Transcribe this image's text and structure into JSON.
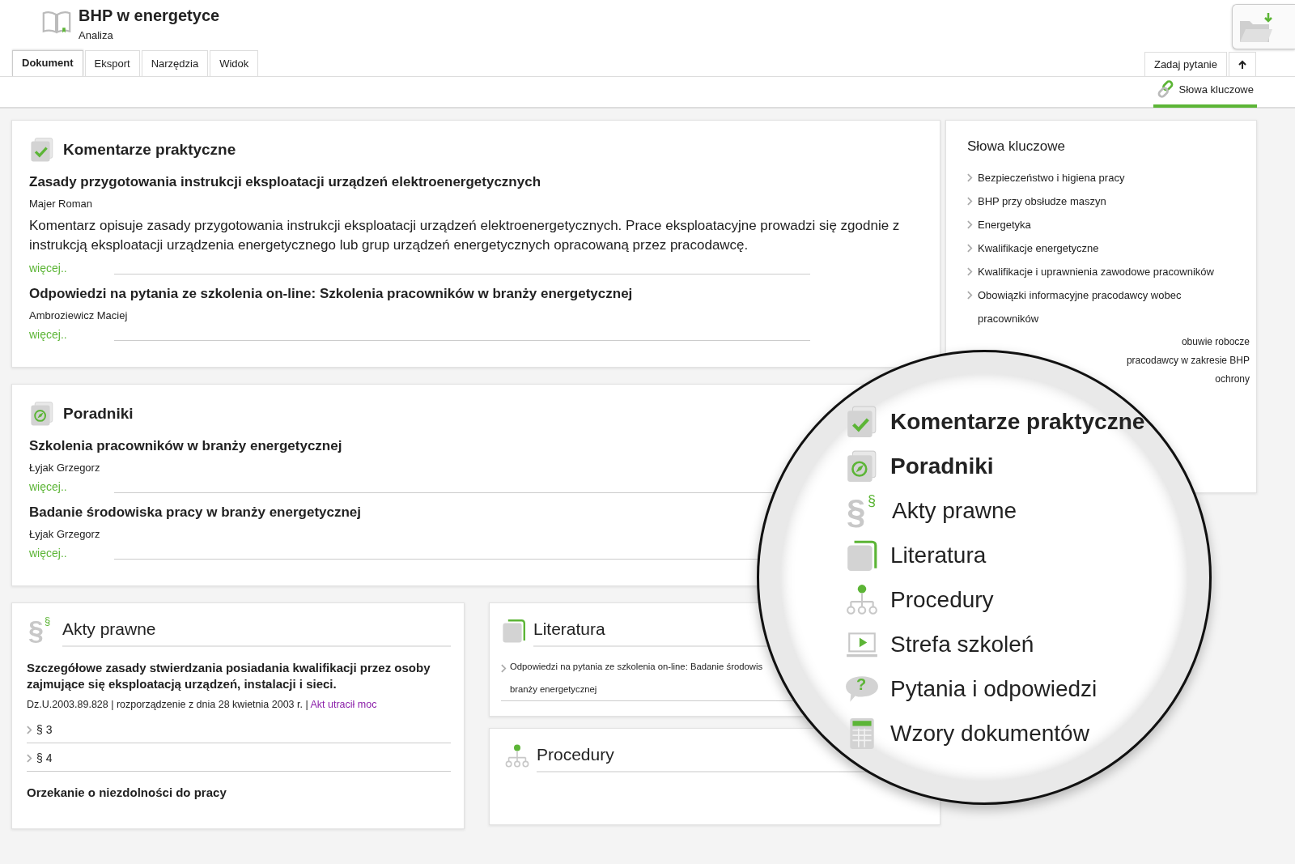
{
  "header": {
    "title": "BHP w energetyce",
    "subtitle": "Analiza"
  },
  "tabs": [
    {
      "label": "Dokument",
      "selected": true
    },
    {
      "label": "Eksport",
      "selected": false
    },
    {
      "label": "Narzędzia",
      "selected": false
    },
    {
      "label": "Widok",
      "selected": false
    }
  ],
  "ask_button": "Zadaj pytanie",
  "keywords_tab": {
    "label": "Słowa kluczowe",
    "selected": true
  },
  "sections": [
    {
      "kind": "check",
      "title": "Komentarze praktyczne",
      "entries": [
        {
          "title": "Zasady przygotowania instrukcji eksploatacji urządzeń elektroenergetycznych",
          "author": "Majer Roman",
          "summary": "Komentarz opisuje zasady przygotowania instrukcji eksploatacji urządzeń elektroenergetycznych. Prace eksploatacyjne prowadzi się zgodnie z instrukcją eksploatacji urządzenia energetycznego lub grup urządzeń energetycznych opracowaną przez pracodawcę.",
          "more": "więcej.."
        },
        {
          "title": "Odpowiedzi na pytania ze szkolenia on-line: Szkolenia pracowników w branży energetycznej",
          "author": "Ambroziewicz Maciej",
          "more": "więcej.."
        }
      ]
    },
    {
      "kind": "compass",
      "title": "Poradniki",
      "entries": [
        {
          "title": "Szkolenia pracowników w branży energetycznej",
          "author": "Łyjak Grzegorz",
          "more": "więcej.."
        },
        {
          "title": "Badanie środowiska pracy w branży energetycznej",
          "author": "Łyjak Grzegorz",
          "more": "więcej.."
        }
      ]
    }
  ],
  "legal": {
    "icon_glyphs": [
      "§",
      "§"
    ],
    "title": "Akty prawne",
    "acts": [
      {
        "title": "Szczegółowe zasady stwierdzania posiadania kwalifikacji przez osoby zajmujące się eksploatacją urządzeń, instalacji i sieci.",
        "meta": "Dz.U.2003.89.828 | rozporządzenie z dnia 28 kwietnia 2003 r. |",
        "status": "Akt utracił moc",
        "paragraphs": [
          "§ 3",
          "§ 4"
        ]
      },
      {
        "title": "Orzekanie o niezdolności do pracy"
      }
    ]
  },
  "literature": {
    "title": "Literatura",
    "items": [
      {
        "first_line": "Odpowiedzi na pytania ze szkolenia on-line: Badanie środowis",
        "second_line": "branży energetycznej"
      }
    ]
  },
  "procedures": {
    "title": "Procedury"
  },
  "keywords": {
    "title": "Słowa kluczowe",
    "items": [
      {
        "label": "Bezpieczeństwo i higiena pracy",
        "kind": "full"
      },
      {
        "label": "BHP przy obsłudze maszyn",
        "kind": "full"
      },
      {
        "label": "Energetyka",
        "kind": "full"
      },
      {
        "label": "Kwalifikacje energetyczne",
        "kind": "full"
      },
      {
        "label": "Kwalifikacje i uprawnienia zawodowe pracowników",
        "kind": "full"
      },
      {
        "label": "Obowiązki informacyjne pracodawcy wobec pracowników",
        "kind": "full"
      },
      {
        "label": "obuwie robocze",
        "kind": "fragment"
      },
      {
        "label": "pracodawcy w zakresie BHP",
        "kind": "fragment"
      },
      {
        "label": "ochrony",
        "kind": "fragment"
      }
    ]
  },
  "magnifier": {
    "items": [
      {
        "label": "Komentarze praktyczne",
        "kind": "check",
        "bold": true
      },
      {
        "label": "Poradniki",
        "kind": "compass",
        "bold": true
      },
      {
        "label": "Akty prawne",
        "kind": "paragraph",
        "glyphs": [
          "§",
          "§"
        ],
        "bold": false
      },
      {
        "label": "Literatura",
        "kind": "book",
        "bold": false
      },
      {
        "label": "Procedury",
        "kind": "tree",
        "bold": false
      },
      {
        "label": "Strefa szkoleń",
        "kind": "play",
        "bold": false
      },
      {
        "label": "Pytania i odpowiedzi",
        "kind": "question",
        "glyphs": [
          "?"
        ],
        "bold": false
      },
      {
        "label": "Wzory dokumentów",
        "kind": "calculator",
        "bold": false
      }
    ]
  }
}
